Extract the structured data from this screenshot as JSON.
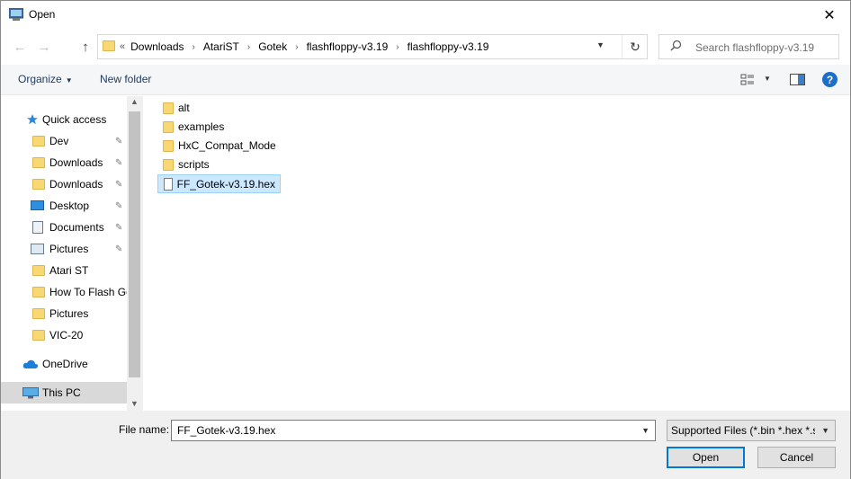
{
  "window": {
    "title": "Open",
    "close_glyph": "✕"
  },
  "nav": {
    "back_glyph": "←",
    "forward_glyph": "→",
    "up_glyph": "↑",
    "address_lead": "«",
    "breadcrumbs": [
      "Downloads",
      "AtariST",
      "Gotek",
      "flashfloppy-v3.19",
      "flashfloppy-v3.19"
    ],
    "breadcrumb_separator": "›",
    "refresh_glyph": "↻",
    "search_placeholder": "Search flashfloppy-v3.19"
  },
  "toolbar": {
    "organize_label": "Organize",
    "new_folder_label": "New folder",
    "help_label": "?"
  },
  "sidebar": {
    "items": [
      {
        "label": "Quick access",
        "icon": "star-icon",
        "pinned": false
      },
      {
        "label": "Dev",
        "icon": "folder-icon",
        "pinned": true
      },
      {
        "label": "Downloads",
        "icon": "folder-icon",
        "pinned": true
      },
      {
        "label": "Downloads",
        "icon": "folder-icon",
        "pinned": true
      },
      {
        "label": "Desktop",
        "icon": "desktop-icon",
        "pinned": true
      },
      {
        "label": "Documents",
        "icon": "documents-icon",
        "pinned": true
      },
      {
        "label": "Pictures",
        "icon": "pictures-icon",
        "pinned": true
      },
      {
        "label": "Atari ST",
        "icon": "folder-icon",
        "pinned": false
      },
      {
        "label": "How To Flash Gotek",
        "icon": "folder-icon",
        "pinned": false
      },
      {
        "label": "Pictures",
        "icon": "folder-icon",
        "pinned": false
      },
      {
        "label": "VIC-20",
        "icon": "folder-icon",
        "pinned": false
      },
      {
        "label": "OneDrive",
        "icon": "cloud-icon",
        "pinned": false
      },
      {
        "label": "This PC",
        "icon": "computer-icon",
        "pinned": false
      }
    ],
    "pin_glyph": "📌"
  },
  "files": [
    {
      "name": "alt",
      "type": "folder"
    },
    {
      "name": "examples",
      "type": "folder"
    },
    {
      "name": "HxC_Compat_Mode",
      "type": "folder"
    },
    {
      "name": "scripts",
      "type": "folder"
    },
    {
      "name": "FF_Gotek-v3.19.hex",
      "type": "file",
      "selected": true
    }
  ],
  "footer": {
    "file_name_label": "File name:",
    "file_name_value": "FF_Gotek-v3.19.hex",
    "file_type_value": "Supported Files (*.bin *.hex *.sr",
    "open_label": "Open",
    "cancel_label": "Cancel"
  },
  "colors": {
    "accent": "#0078d7",
    "selection": "#cce8ff",
    "folder": "#f8d775",
    "link_text": "#1e395b"
  }
}
